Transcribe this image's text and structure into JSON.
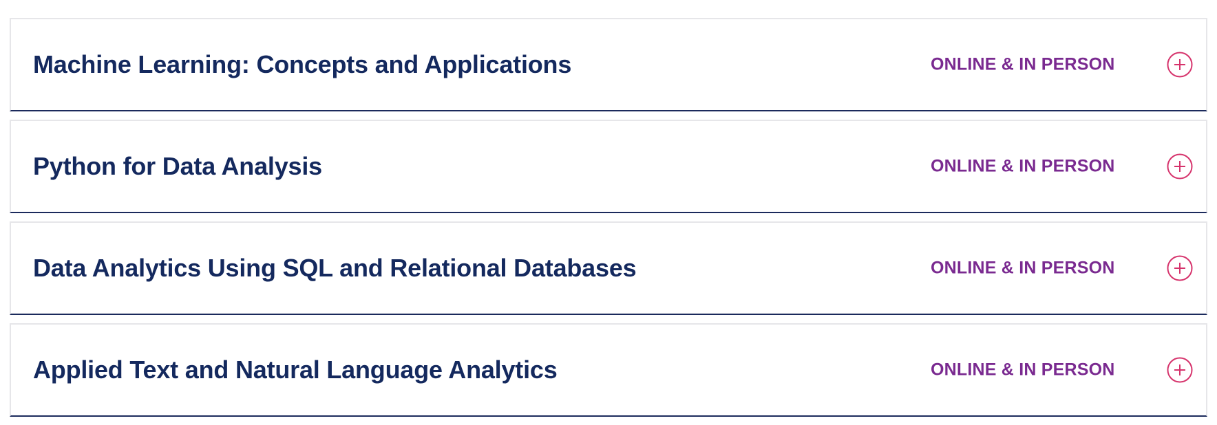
{
  "courses": [
    {
      "title": "Machine Learning: Concepts and Applications",
      "format": "ONLINE & IN PERSON",
      "icon": "plus-circle-icon"
    },
    {
      "title": "Python for Data Analysis",
      "format": "ONLINE & IN PERSON",
      "icon": "plus-circle-icon"
    },
    {
      "title": "Data Analytics Using SQL and Relational Databases",
      "format": "ONLINE & IN PERSON",
      "icon": "plus-circle-icon"
    },
    {
      "title": "Applied Text and Natural Language Analytics",
      "format": "ONLINE & IN PERSON",
      "icon": "plus-circle-icon"
    }
  ],
  "colors": {
    "title": "#14295e",
    "format": "#7a2a90",
    "icon": "#d6336c",
    "row_border": "#e6e6e9",
    "row_bottom_border": "#1b2a5c"
  }
}
